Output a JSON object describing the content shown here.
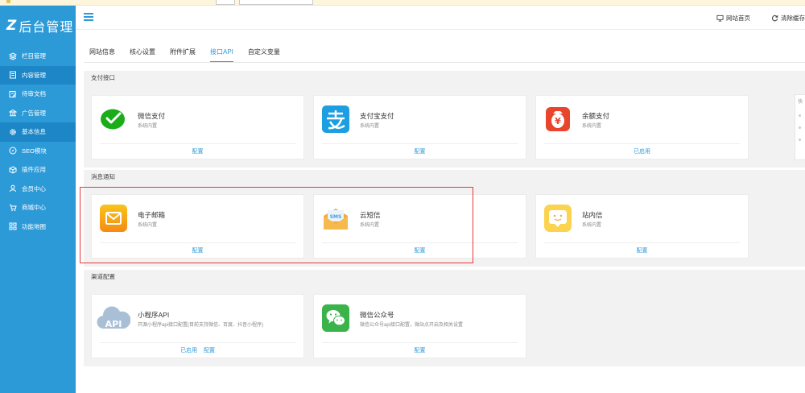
{
  "app": {
    "logo_mark": "Z",
    "logo_text": "后台管理"
  },
  "sidebar": {
    "items": [
      {
        "label": "栏目管理",
        "icon": "layers-icon",
        "active": false
      },
      {
        "label": "内容管理",
        "icon": "document-icon",
        "active": true
      },
      {
        "label": "待审文档",
        "icon": "edit-document-icon",
        "active": false
      },
      {
        "label": "广告管理",
        "icon": "bank-icon",
        "active": false
      },
      {
        "label": "基本信息",
        "icon": "gear-icon",
        "active": true
      },
      {
        "label": "SEO模块",
        "icon": "compass-icon",
        "active": false
      },
      {
        "label": "插件应用",
        "icon": "cube-icon",
        "active": false
      },
      {
        "label": "会员中心",
        "icon": "user-icon",
        "active": false
      },
      {
        "label": "商城中心",
        "icon": "cart-icon",
        "active": false
      },
      {
        "label": "功能地图",
        "icon": "grid-icon",
        "active": false
      }
    ]
  },
  "header": {
    "site_home": "网站首页",
    "clear_cache": "清除缓存"
  },
  "tabs": [
    {
      "label": "网站信息",
      "active": false
    },
    {
      "label": "核心设置",
      "active": false
    },
    {
      "label": "附件扩展",
      "active": false
    },
    {
      "label": "接口API",
      "active": true
    },
    {
      "label": "自定义变量",
      "active": false
    }
  ],
  "sections": {
    "payment": {
      "title": "支付接口",
      "cards": [
        {
          "title": "微信支付",
          "sub": "系统内置",
          "links": [
            "配置"
          ],
          "icon": "wechat-pay-icon"
        },
        {
          "title": "支付宝支付",
          "sub": "系统内置",
          "links": [
            "配置"
          ],
          "icon": "alipay-icon"
        },
        {
          "title": "余额支付",
          "sub": "系统内置",
          "links": [
            "已启用"
          ],
          "icon": "balance-icon"
        }
      ]
    },
    "notify": {
      "title": "消息通知",
      "cards": [
        {
          "title": "电子邮箱",
          "sub": "系统内置",
          "links": [
            "配置"
          ],
          "icon": "email-icon"
        },
        {
          "title": "云短信",
          "sub": "系统内置",
          "links": [
            "配置"
          ],
          "icon": "sms-icon"
        },
        {
          "title": "站内信",
          "sub": "系统内置",
          "links": [
            "配置"
          ],
          "icon": "site-message-icon"
        }
      ]
    },
    "channel": {
      "title": "渠道配置",
      "cards": [
        {
          "title": "小程序API",
          "sub": "开源小程序api接口配置(目前支持微信、百度、抖音小程序)",
          "links": [
            "已启用",
            "配置"
          ],
          "icon": "api-cloud-icon"
        },
        {
          "title": "微信公众号",
          "sub": "微信公众号api接口配置，微站点开启及相关设置",
          "links": [
            "配置"
          ],
          "icon": "wechat-official-icon"
        }
      ]
    }
  },
  "right_widget": {
    "title": "快"
  },
  "colors": {
    "sidebar": "#2d9ad8",
    "accent": "#2d9ad8",
    "highlight": "#e4393c"
  }
}
